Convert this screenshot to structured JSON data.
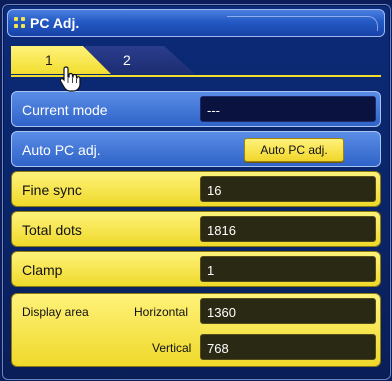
{
  "window": {
    "title": "PC Adj."
  },
  "tabs": [
    {
      "label": "1",
      "selected": true
    },
    {
      "label": "2",
      "selected": false
    }
  ],
  "rows": {
    "current_mode": {
      "label": "Current mode",
      "value": "---"
    },
    "auto_pc_adj": {
      "label": "Auto PC adj.",
      "button_label": "Auto PC adj."
    },
    "fine_sync": {
      "label": "Fine sync",
      "value": "16"
    },
    "total_dots": {
      "label": "Total dots",
      "value": "1816"
    },
    "clamp": {
      "label": "Clamp",
      "value": "1"
    },
    "display_area": {
      "label": "Display area",
      "horizontal_label": "Horizontal",
      "horizontal_value": "1360",
      "vertical_label": "Vertical",
      "vertical_value": "768"
    }
  },
  "icons": {
    "title": "grid-dots-icon",
    "cursor": "hand-pointer-icon"
  },
  "colors": {
    "accent_yellow": "#f2de2e",
    "panel_blue": "#2f63c8",
    "background_navy": "#0b1e5a"
  }
}
